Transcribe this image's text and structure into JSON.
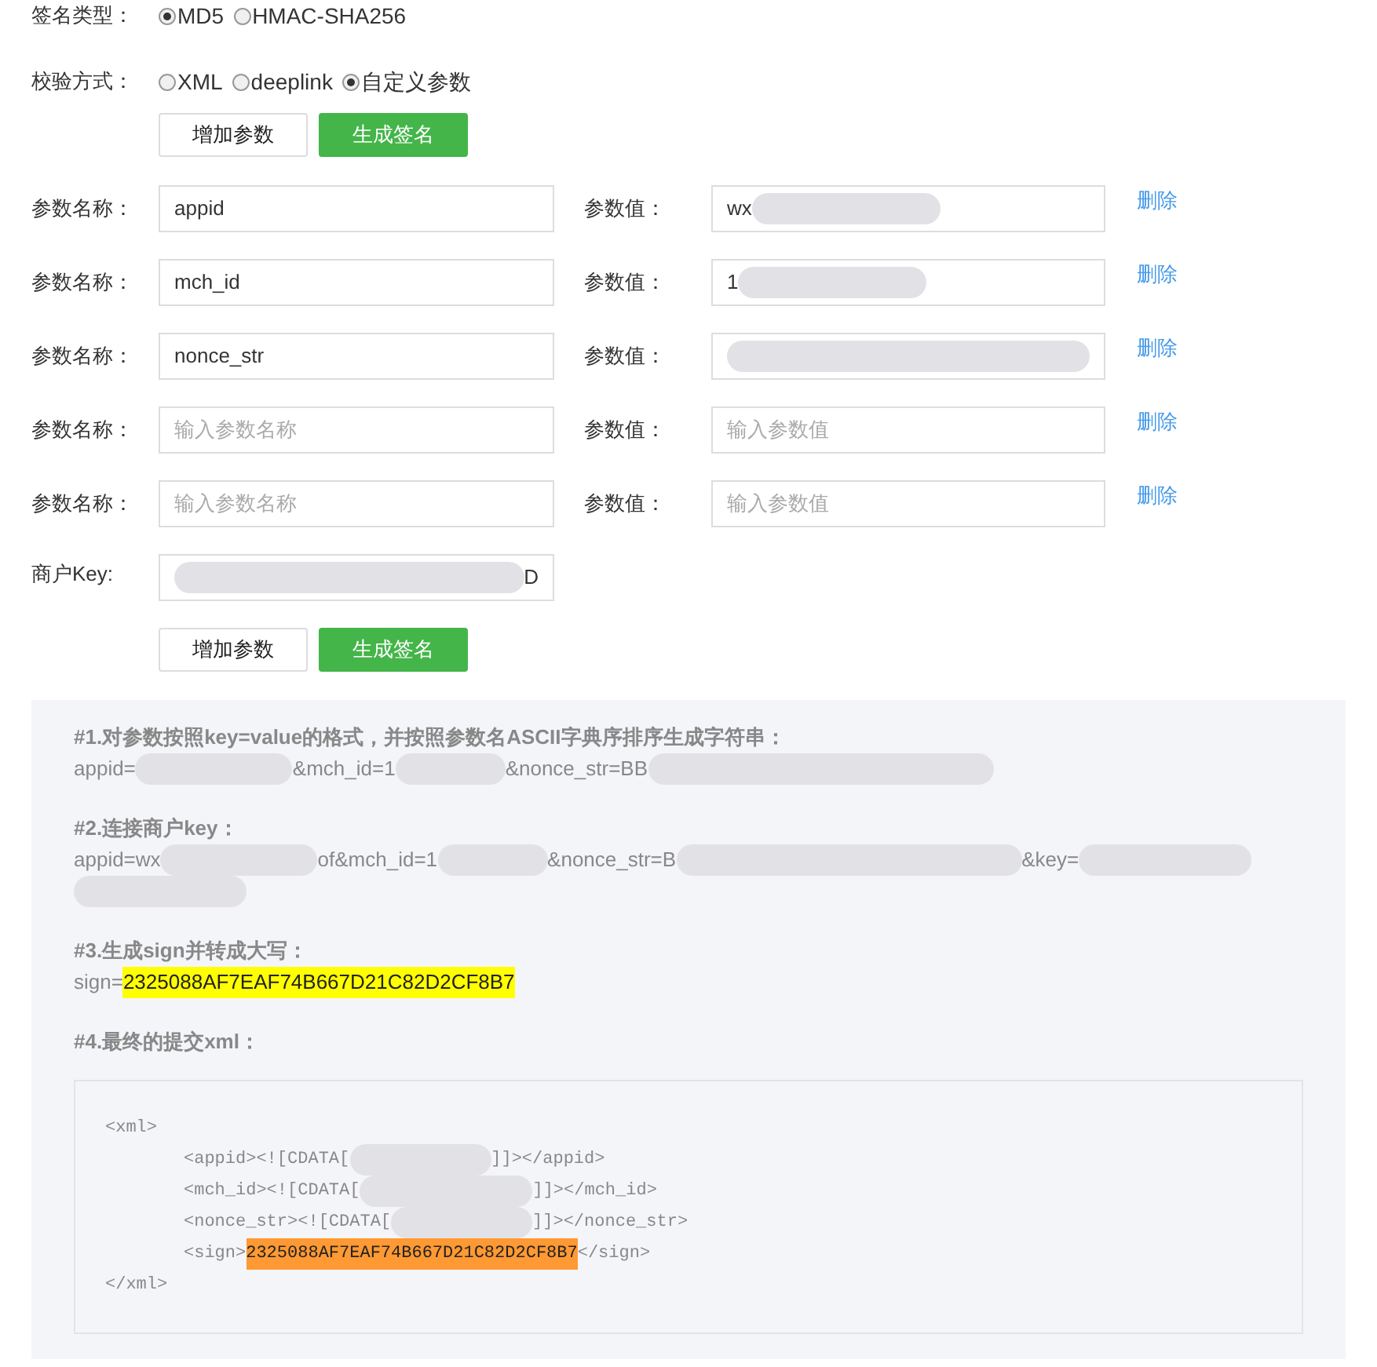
{
  "sign_type": {
    "label": "签名类型：",
    "options": [
      {
        "label": "MD5",
        "selected": true
      },
      {
        "label": "HMAC-SHA256",
        "selected": false
      }
    ]
  },
  "verify_method": {
    "label": "校验方式：",
    "options": [
      {
        "label": "XML",
        "selected": false
      },
      {
        "label": "deeplink",
        "selected": false
      },
      {
        "label": "自定义参数",
        "selected": true
      }
    ]
  },
  "buttons_top": [
    {
      "label": "增加参数",
      "kind": "default"
    },
    {
      "label": "生成签名",
      "kind": "primary"
    }
  ],
  "params": [
    {
      "name_label": "参数名称：",
      "name_value": "appid",
      "value_label": "参数值：",
      "value_parts": [
        {
          "kind": "text",
          "text": "wx"
        },
        {
          "kind": "redacted"
        }
      ],
      "delete": "删除"
    },
    {
      "name_label": "参数名称：",
      "name_value": "mch_id",
      "value_label": "参数值：",
      "value_parts": [
        {
          "kind": "text",
          "text": "1"
        },
        {
          "kind": "redacted"
        }
      ],
      "delete": "删除"
    },
    {
      "name_label": "参数名称：",
      "name_value": "nonce_str",
      "value_label": "参数值：",
      "value_parts": [
        {
          "kind": "redacted"
        }
      ],
      "delete": "删除"
    },
    {
      "name_label": "参数名称：",
      "name_placeholder": "输入参数名称",
      "value_label": "参数值：",
      "value_placeholder": "输入参数值",
      "delete": "删除"
    },
    {
      "name_label": "参数名称：",
      "name_placeholder": "输入参数名称",
      "value_label": "参数值：",
      "value_placeholder": "输入参数值",
      "delete": "删除"
    }
  ],
  "merchant_key": {
    "label": "商户Key:",
    "value_parts": [
      {
        "kind": "redacted"
      },
      {
        "kind": "text",
        "text": "D"
      }
    ]
  },
  "buttons_bottom": [
    {
      "label": "增加参数",
      "kind": "default"
    },
    {
      "label": "生成签名",
      "kind": "primary"
    }
  ],
  "steps": [
    {
      "title": "#1.对参数按照key=value的格式，并按照参数名ASCII字典序排序生成字符串：",
      "lines": [
        [
          {
            "kind": "text",
            "text": "appid="
          },
          {
            "kind": "redacted"
          },
          {
            "kind": "text",
            "text": "&mch_id=1"
          },
          {
            "kind": "redacted"
          },
          {
            "kind": "text",
            "text": "&nonce_str=BB"
          },
          {
            "kind": "redacted"
          }
        ]
      ]
    },
    {
      "title": "#2.连接商户key：",
      "lines": [
        [
          {
            "kind": "text",
            "text": "appid=wx"
          },
          {
            "kind": "redacted"
          },
          {
            "kind": "text",
            "text": "of&mch_id=1"
          },
          {
            "kind": "redacted"
          },
          {
            "kind": "text",
            "text": "&nonce_str=B"
          },
          {
            "kind": "redacted"
          },
          {
            "kind": "text",
            "text": "&key="
          },
          {
            "kind": "redacted"
          }
        ],
        [
          {
            "kind": "redacted"
          }
        ]
      ]
    },
    {
      "title": "#3.生成sign并转成大写：",
      "lines": [
        [
          {
            "kind": "text",
            "text": "sign="
          },
          {
            "kind": "highlight",
            "text": "2325088AF7EAF74B667D21C82D2CF8B7"
          }
        ]
      ]
    },
    {
      "title": "#4.最终的提交xml：",
      "code": [
        [
          {
            "kind": "text",
            "text": "<xml>"
          }
        ],
        [
          {
            "kind": "text",
            "text": "<appid><![CDATA["
          },
          {
            "kind": "redacted"
          },
          {
            "kind": "text",
            "text": "]]></appid>"
          }
        ],
        [
          {
            "kind": "text",
            "text": "<mch_id><![CDATA["
          },
          {
            "kind": "redacted"
          },
          {
            "kind": "text",
            "text": "]]></mch_id>"
          }
        ],
        [
          {
            "kind": "text",
            "text": "<nonce_str><![CDATA["
          },
          {
            "kind": "redacted"
          },
          {
            "kind": "text",
            "text": "]]></nonce_str>"
          }
        ],
        [
          {
            "kind": "text",
            "text": "<sign>"
          },
          {
            "kind": "highlight",
            "text": "2325088AF7EAF74B667D21C82D2CF8B7"
          },
          {
            "kind": "text",
            "text": "</sign>"
          }
        ],
        [
          {
            "kind": "text",
            "text": "</xml>"
          }
        ]
      ]
    }
  ]
}
